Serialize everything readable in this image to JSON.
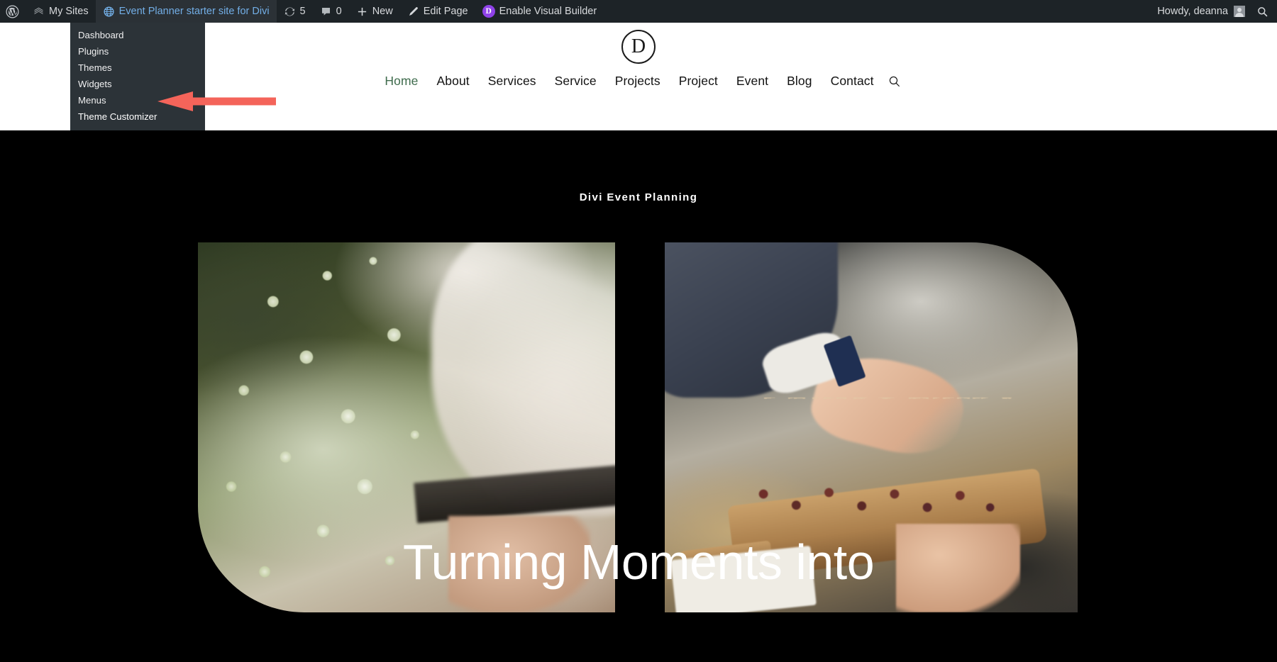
{
  "adminbar": {
    "wp_logo": "wordpress-logo-icon",
    "my_sites": "My Sites",
    "site_name": "Event Planner starter site for Divi",
    "updates_count": "5",
    "comments_count": "0",
    "new_label": "New",
    "edit_page_label": "Edit Page",
    "divi_badge": "D",
    "visual_builder_label": "Enable Visual Builder",
    "howdy": "Howdy, deanna",
    "search_icon": "search-icon"
  },
  "mysites_menu": {
    "items": [
      {
        "label": "Dashboard"
      },
      {
        "label": "Plugins"
      },
      {
        "label": "Themes"
      },
      {
        "label": "Widgets"
      },
      {
        "label": "Menus"
      },
      {
        "label": "Theme Customizer"
      }
    ],
    "highlighted": "Theme Customizer"
  },
  "annotation": {
    "arrow_color": "#f4645a",
    "points_to": "Theme Customizer"
  },
  "site": {
    "logo_letter": "D",
    "nav": [
      {
        "label": "Home",
        "active": true
      },
      {
        "label": "About",
        "active": false
      },
      {
        "label": "Services",
        "active": false
      },
      {
        "label": "Service",
        "active": false
      },
      {
        "label": "Projects",
        "active": false
      },
      {
        "label": "Project",
        "active": false
      },
      {
        "label": "Event",
        "active": false
      },
      {
        "label": "Blog",
        "active": false
      },
      {
        "label": "Contact",
        "active": false
      }
    ],
    "nav_search_icon": "search-icon"
  },
  "hero": {
    "eyebrow": "Divi Event Planning",
    "headline": "Turning Moments into",
    "background_color": "#000000",
    "images": [
      {
        "alt": "bride holding white flower bouquet"
      },
      {
        "alt": "hand taking appetizer from wooden serving board"
      }
    ]
  },
  "colors": {
    "adminbar_bg": "#1d2327",
    "menu_bg": "#2c3338",
    "site_link": "#72aee6",
    "divi_purple": "#8f42e8",
    "nav_active": "#3e6b4c"
  }
}
